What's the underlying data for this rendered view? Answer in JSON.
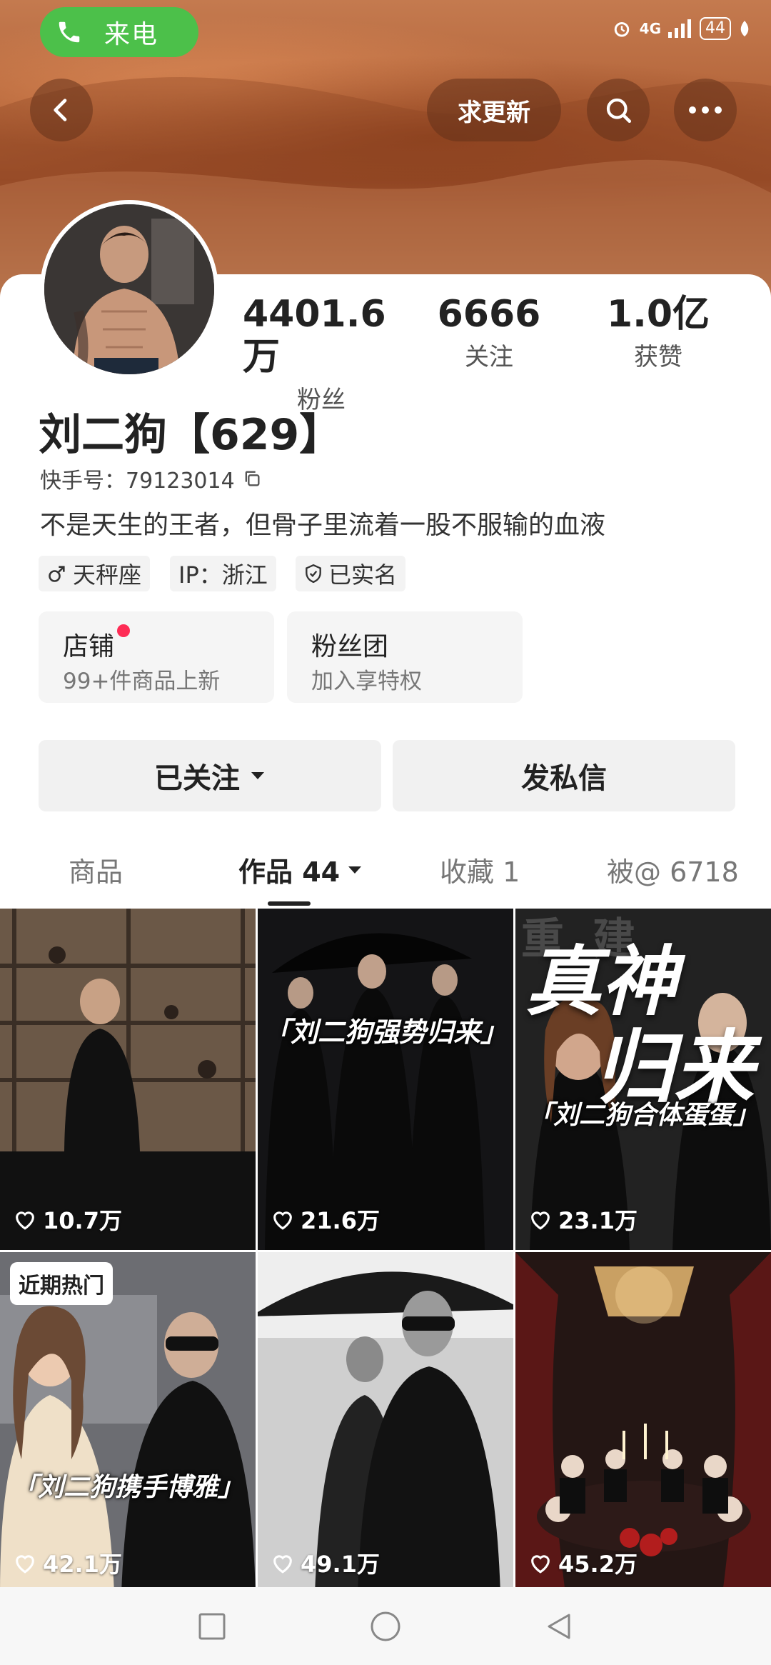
{
  "status": {
    "call_label": "来电",
    "network": "4G",
    "battery": "44"
  },
  "header": {
    "request_update": "求更新"
  },
  "stats": [
    {
      "value": "4401.6万",
      "label": "粉丝"
    },
    {
      "value": "6666",
      "label": "关注"
    },
    {
      "value": "1.0亿",
      "label": "获赞"
    }
  ],
  "profile": {
    "name": "刘二狗【629】",
    "kuaishou_id": "快手号：79123014",
    "bio": "不是天生的王者，但骨子里流着一股不服输的血液",
    "tags": [
      "天秤座",
      "IP：浙江",
      "已实名"
    ]
  },
  "shortcuts": [
    {
      "title": "店铺",
      "subtitle": "99+件商品上新",
      "has_dot": true
    },
    {
      "title": "粉丝团",
      "subtitle": "加入享特权",
      "has_dot": false
    }
  ],
  "actions": {
    "follow_label": "已关注",
    "message_label": "发私信"
  },
  "tabs": [
    "商品",
    "作品 44",
    "收藏 1",
    "被@ 6718"
  ],
  "active_tab": "作品 44",
  "videos": [
    {
      "likes": "10.7万",
      "caption": "",
      "badge": ""
    },
    {
      "likes": "21.6万",
      "caption": "「刘二狗强势归来」",
      "badge": ""
    },
    {
      "likes": "23.1万",
      "caption": "「刘二狗合体蛋蛋」",
      "badge": "",
      "big_text_1": "真神",
      "big_text_2": "归来",
      "faded_text": "重建"
    },
    {
      "likes": "42.1万",
      "caption": "「刘二狗携手博雅」",
      "badge": "近期热门"
    },
    {
      "likes": "49.1万",
      "caption": "",
      "badge": ""
    },
    {
      "likes": "45.2万",
      "caption": "",
      "badge": ""
    }
  ]
}
